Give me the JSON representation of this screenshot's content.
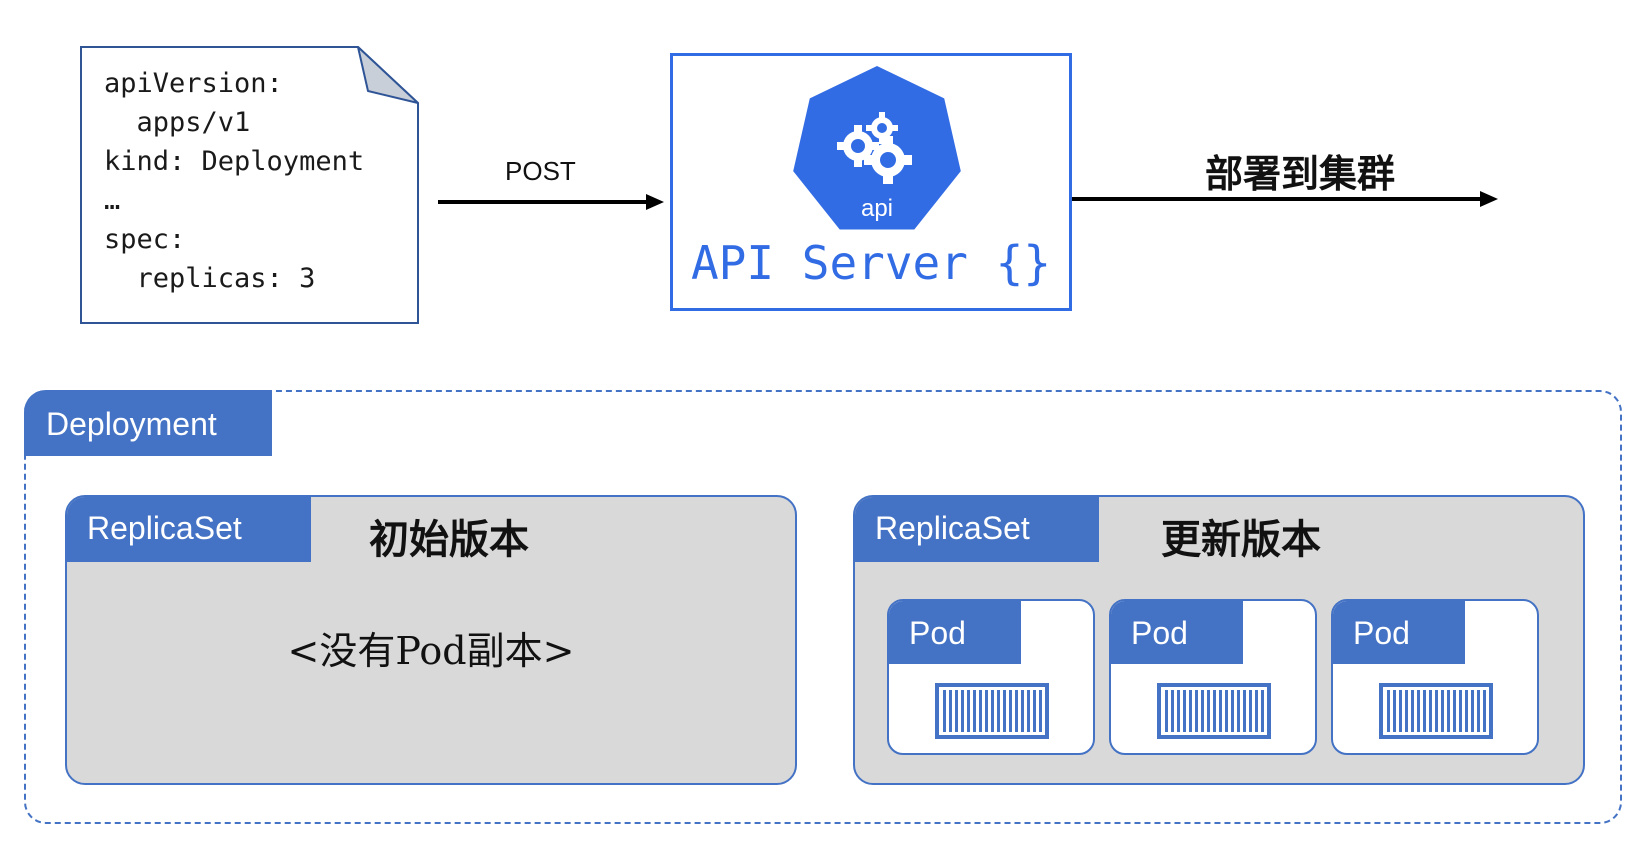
{
  "yaml_manifest": {
    "lines": [
      "apiVersion:",
      "  apps/v1",
      "kind: Deployment",
      "…",
      "spec:",
      "  replicas: 3"
    ]
  },
  "post_arrow": {
    "label": "POST"
  },
  "api_server": {
    "logo_text": "api",
    "label": "API Server {}"
  },
  "deploy_arrow": {
    "label": "部署到集群"
  },
  "deployment": {
    "title": "Deployment",
    "replicasets": [
      {
        "tab_label": "ReplicaSet",
        "version_label": "初始版本",
        "empty_text": "<没有Pod副本>"
      },
      {
        "tab_label": "ReplicaSet",
        "version_label": "更新版本",
        "pods": [
          {
            "label": "Pod"
          },
          {
            "label": "Pod"
          },
          {
            "label": "Pod"
          }
        ]
      }
    ]
  },
  "colors": {
    "k8s_blue": "#326ce5",
    "tab_blue": "#4472c4",
    "replicaset_fill": "#d9d9d9"
  }
}
